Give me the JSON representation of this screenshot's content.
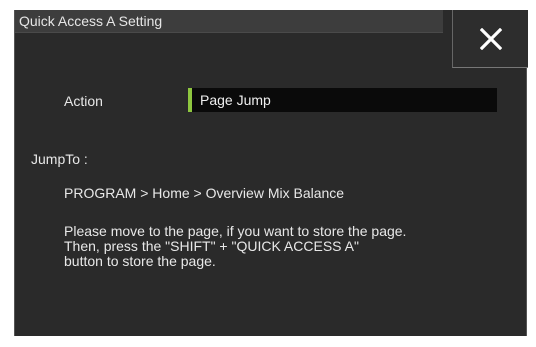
{
  "dialog": {
    "title": "Quick Access A Setting",
    "close_icon": "close-icon"
  },
  "action": {
    "label": "Action",
    "value": "Page Jump",
    "marker_color": "#8ec63f"
  },
  "jump_to": {
    "label": "JumpTo :",
    "path": "PROGRAM > Home > Overview Mix Balance"
  },
  "message": {
    "line1": "Please move to the page, if you want to store the page.",
    "line2": "Then, press the \"SHIFT\" + \"QUICK ACCESS A\"",
    "line3": "button to store the page."
  }
}
